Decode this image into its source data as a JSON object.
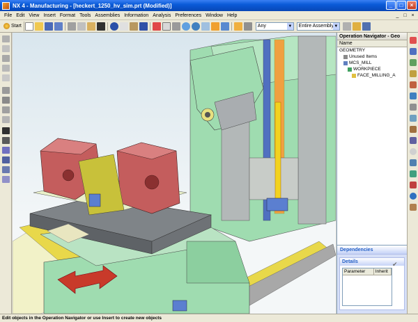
{
  "window": {
    "title": "NX 4 - Manufacturing - [heckert_1250_hv_sim.prt (Modified)]",
    "minimize_glyph": "_",
    "maximize_glyph": "□",
    "close_glyph": "×"
  },
  "menubar": {
    "items": [
      "File",
      "Edit",
      "View",
      "Insert",
      "Format",
      "Tools",
      "Assemblies",
      "Information",
      "Analysis",
      "Preferences",
      "Window",
      "Help"
    ]
  },
  "toolbar": {
    "start_label": "Start",
    "dropdown_filter": "Any",
    "dropdown_scope": "Entire Assembly",
    "arrow_glyph": "▼"
  },
  "navigator": {
    "title": "Operation Navigator - Geo",
    "column_name": "Name",
    "tree": [
      {
        "label": "GEOMETRY",
        "level": 0
      },
      {
        "label": "Unused Items",
        "level": 1
      },
      {
        "label": "MCS_MILL",
        "level": 1
      },
      {
        "label": "WORKPIECE",
        "level": 2
      },
      {
        "label": "FACE_MILLING_A",
        "level": 3
      }
    ]
  },
  "dependencies_label": "Dependencies",
  "details": {
    "title": "Details",
    "columns": [
      "Parameter",
      "Inherit"
    ],
    "check_glyph": "✔"
  },
  "statusbar": {
    "message": "Edit objects in the Operation Navigator or use Insert to create new objects"
  },
  "colors": {
    "titlebar": "#0a5bd8",
    "chrome": "#ece9d8",
    "panel_accent": "#215dc6",
    "machine_green": "#9fdcb0",
    "machine_gray": "#b3b8b8",
    "part_red": "#c45d5d",
    "spindle_yellow": "#f2d21f",
    "rail_yellow": "#e8d84a"
  }
}
